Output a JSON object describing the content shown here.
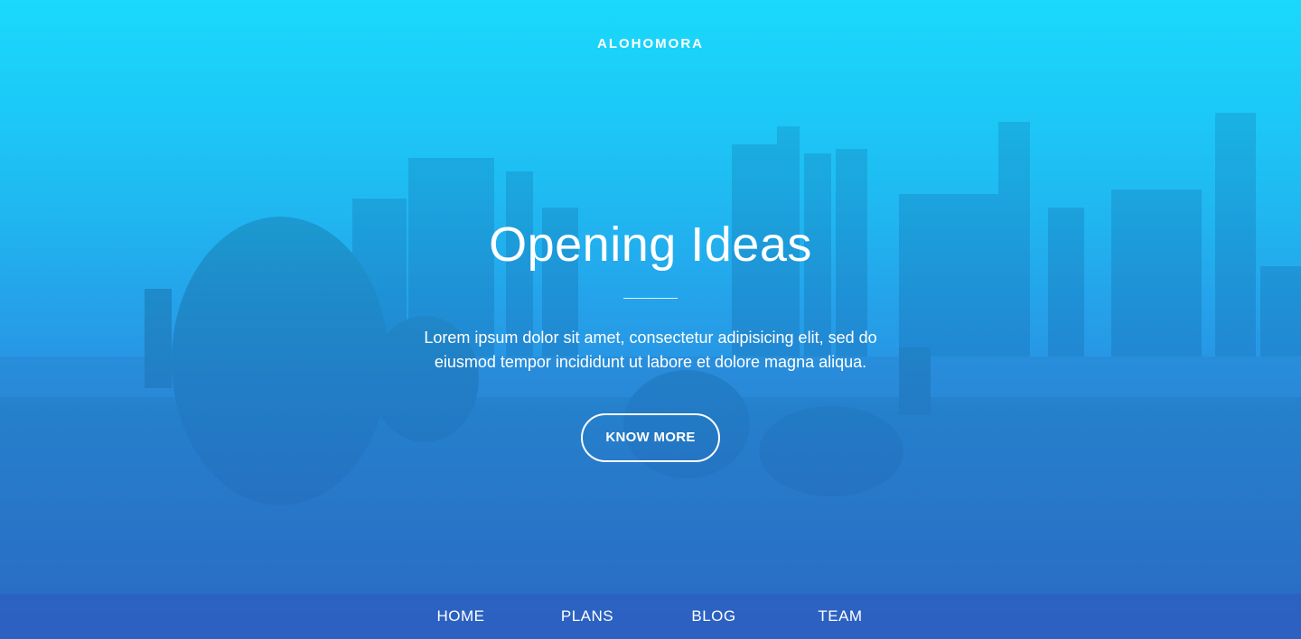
{
  "brand": {
    "name": "ALOHOMORA"
  },
  "hero": {
    "title": "Opening Ideas",
    "description": "Lorem ipsum dolor sit amet, consectetur adipisicing elit, sed do eiusmod tempor incididunt ut labore et dolore magna aliqua.",
    "cta_label": "KNOW MORE"
  },
  "nav": {
    "items": [
      {
        "label": "HOME"
      },
      {
        "label": "PLANS"
      },
      {
        "label": "BLOG"
      },
      {
        "label": "TEAM"
      }
    ]
  },
  "colors": {
    "gradient_top": "#19d9fc",
    "gradient_bottom": "#2f6fd2",
    "text": "#ffffff"
  }
}
